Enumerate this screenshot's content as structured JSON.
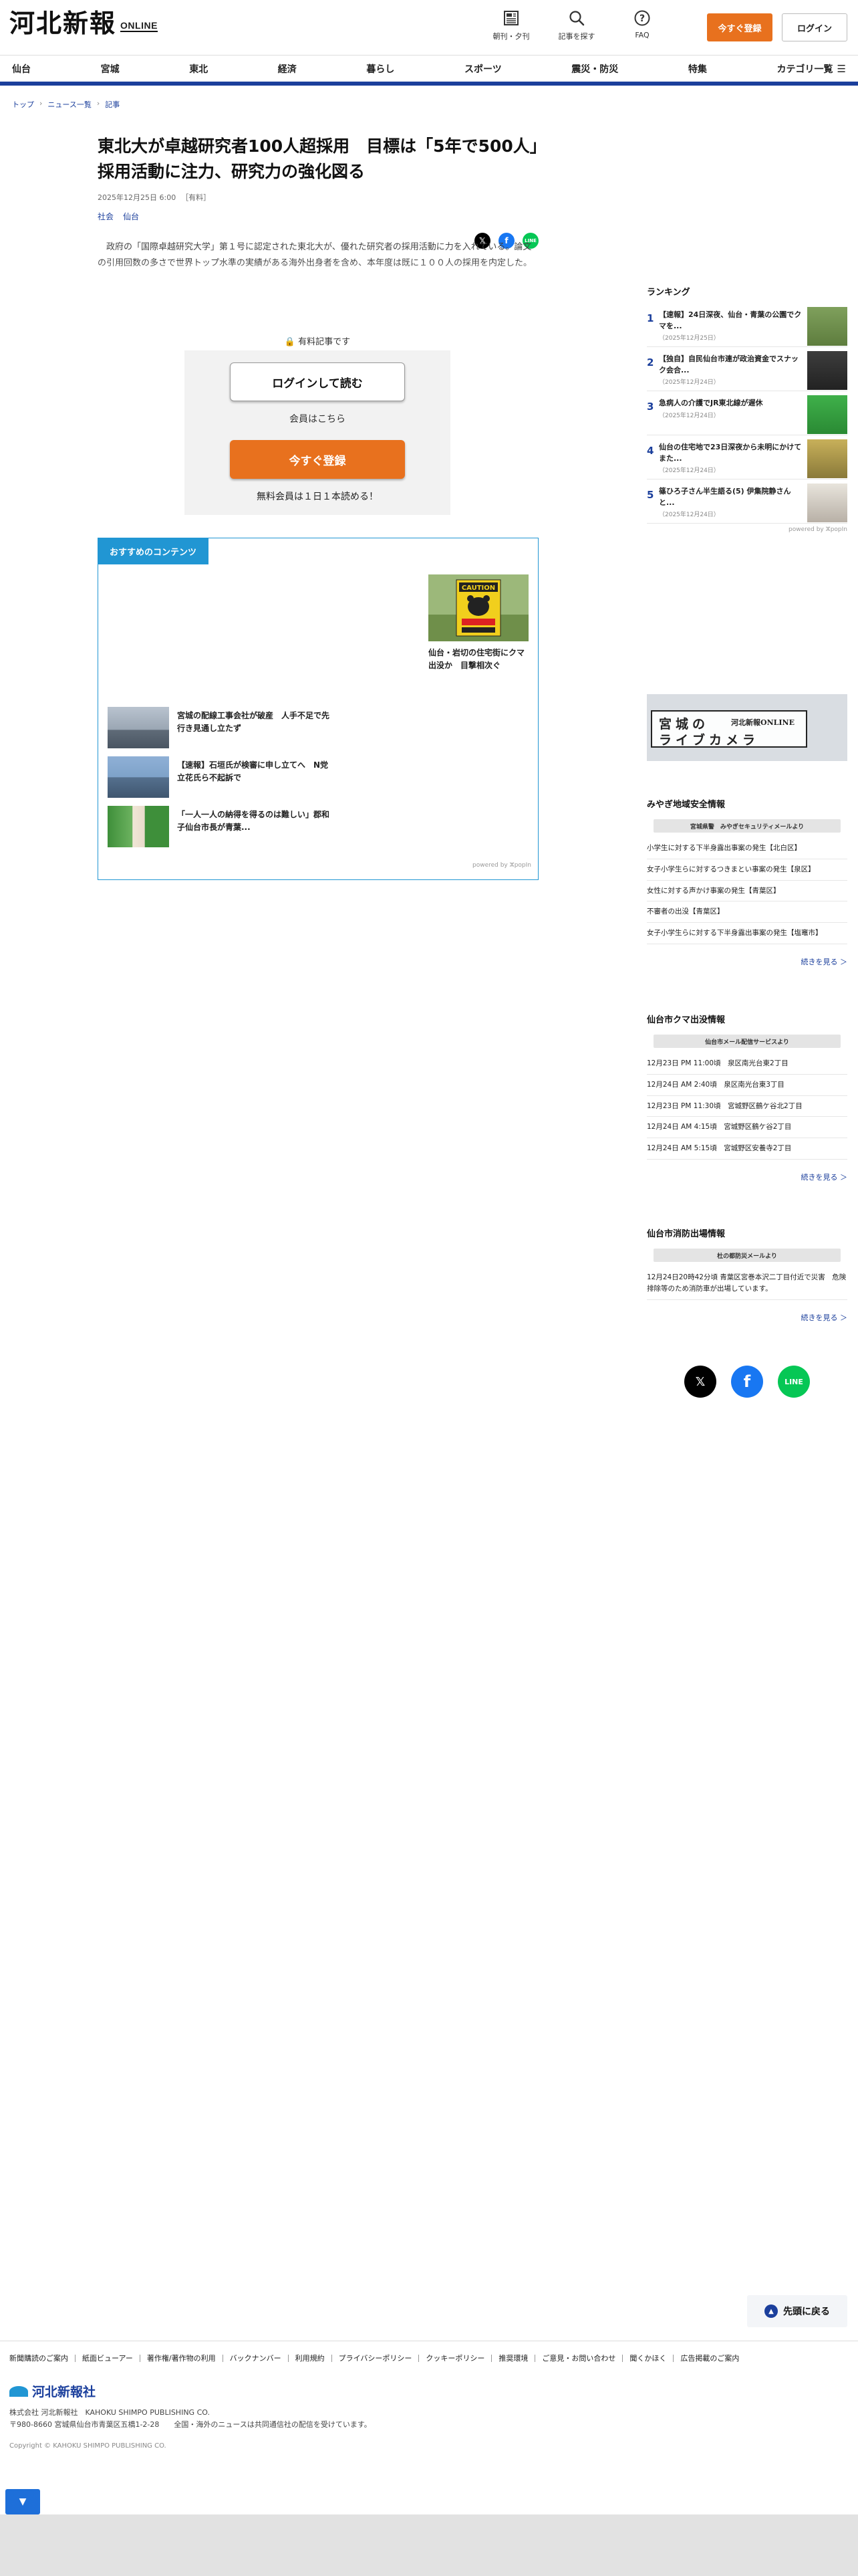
{
  "header": {
    "logo_text": "河北新報",
    "logo_sub": "ONLINE",
    "icons": [
      {
        "label": "朝刊・夕刊",
        "icon": "newspaper-icon"
      },
      {
        "label": "記事を探す",
        "icon": "search-icon"
      },
      {
        "label": "FAQ",
        "icon": "question-icon"
      }
    ],
    "register_label": "今すぐ登録",
    "login_label": "ログイン"
  },
  "nav": {
    "items": [
      "仙台",
      "宮城",
      "東北",
      "経済",
      "暮らし",
      "スポーツ",
      "震災・防災",
      "特集",
      "カテゴリ一覧"
    ]
  },
  "breadcrumb": [
    "トップ",
    "ニュース一覧",
    "記事"
  ],
  "article": {
    "title": "東北大が卓越研究者100人超採用　目標は「5年で500人」　採用活動に注力、研究力の強化図る",
    "date": "2025年12月25日 6:00",
    "badge": "［有料］",
    "tags": [
      "社会",
      "仙台"
    ],
    "lead": "政府の「国際卓越研究大学」第１号に認定された東北大が、優れた研究者の採用活動に力を入れている。論文の引用回数の多さで世界トップ水準の実績がある海外出身者を含め、本年度は既に１００人の採用を内定した。"
  },
  "paywall": {
    "label": "有料記事です",
    "login_label": "ログインして読む",
    "member_label": "会員はこちら",
    "register_label": "今すぐ登録",
    "free_label": "無料会員は１日１本読める！"
  },
  "recommend": {
    "title": "おすすめのコンテンツ",
    "feature": {
      "caption": "仙台・岩切の住宅街にクマ出没か　目撃相次ぐ",
      "sign_text": "CAUTION"
    },
    "items": [
      {
        "caption": "宮城の配線工事会社が破産　人手不足で先行き見通し立たず"
      },
      {
        "caption": "【速報】石垣氏が検審に申し立てへ　N党立花氏ら不起訴で"
      },
      {
        "caption": "「一人一人の納得を得るのは難しい」郡和子仙台市長が青葉..."
      }
    ],
    "powered": "powered by ⵣpopIn"
  },
  "ranking": {
    "title": "ランキング",
    "items": [
      {
        "no": "1",
        "title": "【速報】24日深夜、仙台・青葉の公園でクマを...",
        "date": "（2025年12月25日）"
      },
      {
        "no": "2",
        "title": "【独自】自民仙台市連が政治資金でスナック会合...",
        "date": "（2025年12月24日）"
      },
      {
        "no": "3",
        "title": "急病人の介護でJR東北線が遅休",
        "date": "（2025年12月24日）"
      },
      {
        "no": "4",
        "title": "仙台の住宅地で23日深夜から未明にかけてまた...",
        "date": "（2025年12月24日）"
      },
      {
        "no": "5",
        "title": "篠ひろ子さん半生語る(5) 伊集院静さんと...",
        "date": "（2025年12月24日）"
      }
    ],
    "powered": "powered by ⵣpopIn"
  },
  "livecam": {
    "line1": "宮城の",
    "logo": "河北新報ONLINE",
    "line2": "ライブカメラ"
  },
  "safety": {
    "title": "みやぎ地域安全情報",
    "sub": "宮城県警　みやぎセキュリティメールより",
    "items": [
      "小学生に対する下半身露出事案の発生【北白区】",
      "女子小学生らに対するつきまとい事案の発生【泉区】",
      "女性に対する声かけ事案の発生【青葉区】",
      "不審者の出没【青葉区】",
      "女子小学生らに対する下半身露出事案の発生【塩竈市】"
    ],
    "more": "続きを見る ＞"
  },
  "bear": {
    "title": "仙台市クマ出没情報",
    "sub": "仙台市メール配信サービスより",
    "items": [
      "12月23日 PM 11:00頃　泉区南光台東2丁目",
      "12月24日 AM 2:40頃　泉区南光台東3丁目",
      "12月23日 PM 11:30頃　宮城野区鶴ケ谷北2丁目",
      "12月24日 AM 4:15頃　宮城野区鶴ケ谷2丁目",
      "12月24日 AM 5:15頃　宮城野区安養寺2丁目"
    ],
    "more": "続きを見る ＞"
  },
  "fire": {
    "title": "仙台市消防出場情報",
    "sub": "杜の都防災メールより",
    "items": [
      "12月24日20時42分頃 青葉区宮巻本沢二丁目付近で災害　危険排除等のため消防車が出場しています。"
    ],
    "more": "続きを見る ＞"
  },
  "social": [
    {
      "name": "x-icon",
      "glyph": "𝕏",
      "color": "#000000"
    },
    {
      "name": "facebook-icon",
      "glyph": "f",
      "color": "#1877f2"
    },
    {
      "name": "line-icon",
      "glyph": "LINE",
      "color": "#06c755"
    }
  ],
  "back_to_top": "先頭に戻る",
  "footer": {
    "links": [
      "新聞購読のご案内",
      "紙面ビューアー",
      "著作権/著作物の利用",
      "バックナンバー",
      "利用規約",
      "プライバシーポリシー",
      "クッキーポリシー",
      "推奨環境",
      "ご意見・お問い合わせ",
      "聞くかほく",
      "広告掲載のご案内"
    ],
    "logo": "河北新報社",
    "company1": "株式会社 河北新報社　KAHOKU SHIMPO PUBLISHING CO.",
    "company2": "〒980-8660 宮城県仙台市青葉区五橋1-2-28　　全国・海外のニュースは共同通信社の配信を受けています。",
    "copyright": "Copyright © KAHOKU SHIMPO PUBLISHING CO."
  },
  "colors": {
    "brand_blue": "#1b3f9c",
    "accent_orange": "#e8711e",
    "reco_blue": "#2196d3"
  }
}
